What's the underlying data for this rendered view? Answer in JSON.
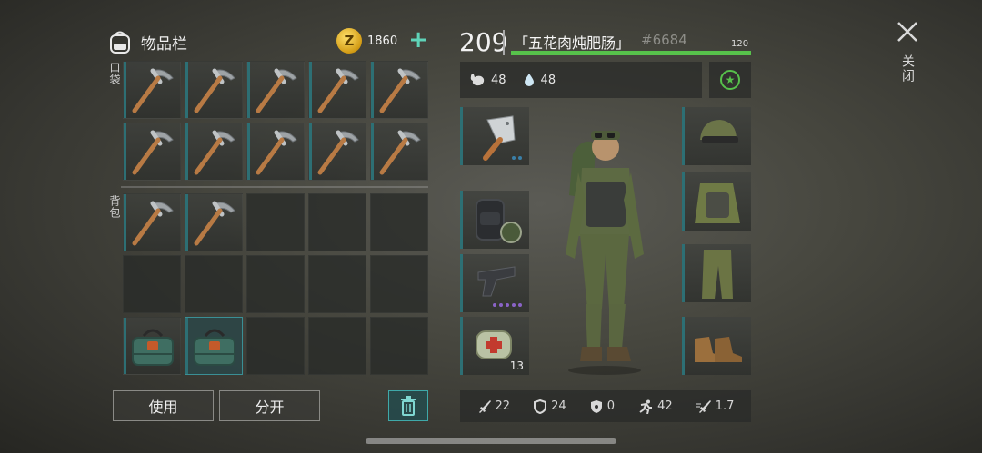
{
  "inventory": {
    "title": "物品栏",
    "coins": "1860",
    "coin_symbol": "Z",
    "pocket_label": "口袋",
    "backpack_label": "背包",
    "use_button": "使用",
    "split_button": "分开"
  },
  "player": {
    "level": "209",
    "name": "「五花肉炖肥肠」",
    "id": "#6684",
    "xp_max": "120",
    "xp_fraction": 0.999,
    "hunger": "48",
    "thirst": "48",
    "accent_color": "#57c24b"
  },
  "equipment": {
    "left_slots": [
      {
        "name": "cleaver-icon",
        "dots": [
          "#3a7fa8",
          "#3a7fa8"
        ]
      },
      {
        "name": "backpack-icon"
      },
      {
        "name": "pistol-icon",
        "dots": [
          "#8a63c7",
          "#8a63c7",
          "#8a63c7",
          "#8a63c7",
          "#8a63c7"
        ]
      },
      {
        "name": "medkit-icon",
        "count": "13"
      }
    ],
    "right_slots": [
      "helmet-goggles-icon",
      "vest-icon",
      "pants-icon",
      "boots-icon"
    ]
  },
  "combat_stats": {
    "damage": "22",
    "armor": "24",
    "radiation": "0",
    "speed": "42",
    "attack_speed": "1.7"
  },
  "close_label": "关闭"
}
